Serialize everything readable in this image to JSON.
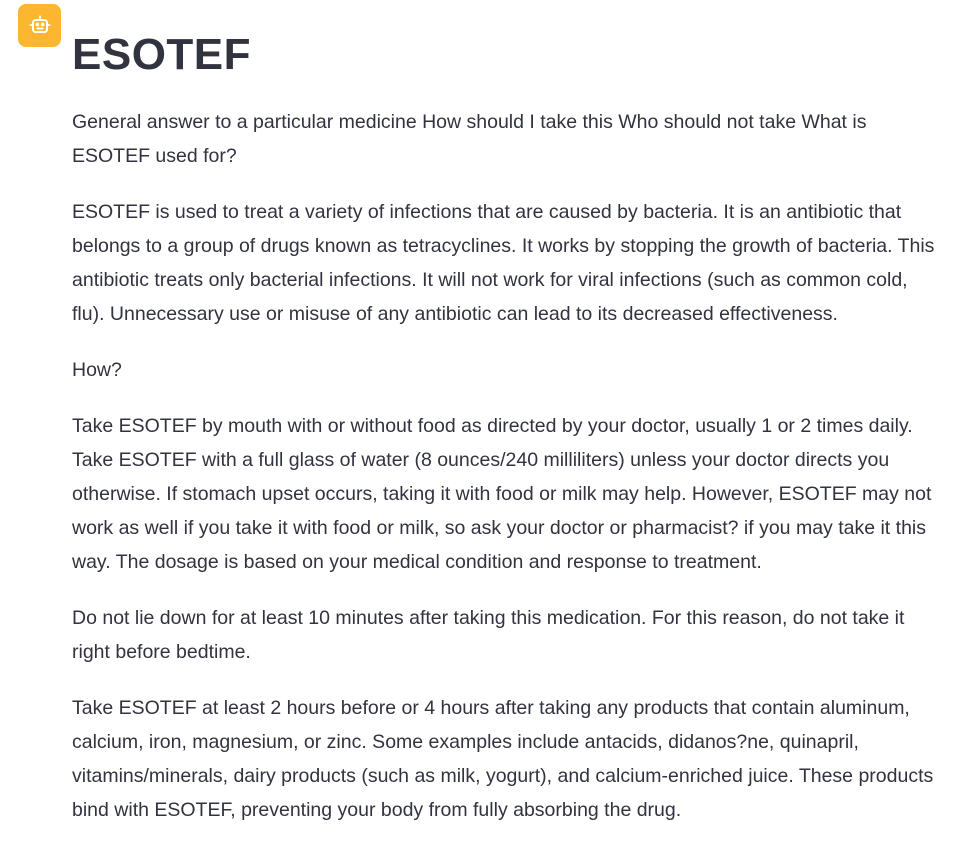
{
  "message": {
    "avatar_icon": "robot-icon",
    "avatar_color": "#fdb62f",
    "title": "ESOTEF",
    "paragraphs": [
      "General answer to a particular medicine How should I take this Who should not take What is ESOTEF used for?",
      "ESOTEF is used to treat a variety of infections that are caused by bacteria. It is an antibiotic that belongs to a group of drugs known as tetracyclines. It works by stopping the growth of bacteria. This antibiotic treats only bacterial infections. It will not work for viral infections (such as common cold, flu). Unnecessary use or misuse of any antibiotic can lead to its decreased effectiveness.",
      "How?",
      "Take ESOTEF by mouth with or without food as directed by your doctor, usually 1 or 2 times daily. Take ESOTEF with a full glass of water (8 ounces/240 milliliters) unless your doctor directs you otherwise. If stomach upset occurs, taking it with food or milk may help. However, ESOTEF may not work as well if you take it with food or milk, so ask your doctor or pharmacist? if you may take it this way. The dosage is based on your medical condition and response to treatment.",
      "Do not lie down for at least 10 minutes after taking this medication. For this reason, do not take it right before bedtime.",
      "Take ESOTEF at least 2 hours before or 4 hours after taking any products that contain aluminum, calcium, iron, magnesium, or zinc. Some examples include antacids, didanos?ne, quinapril, vitamins/minerals, dairy products (such as milk, yogurt), and calcium-enriched juice. These products bind with ESOTEF, preventing your body from fully absorbing the drug."
    ]
  }
}
